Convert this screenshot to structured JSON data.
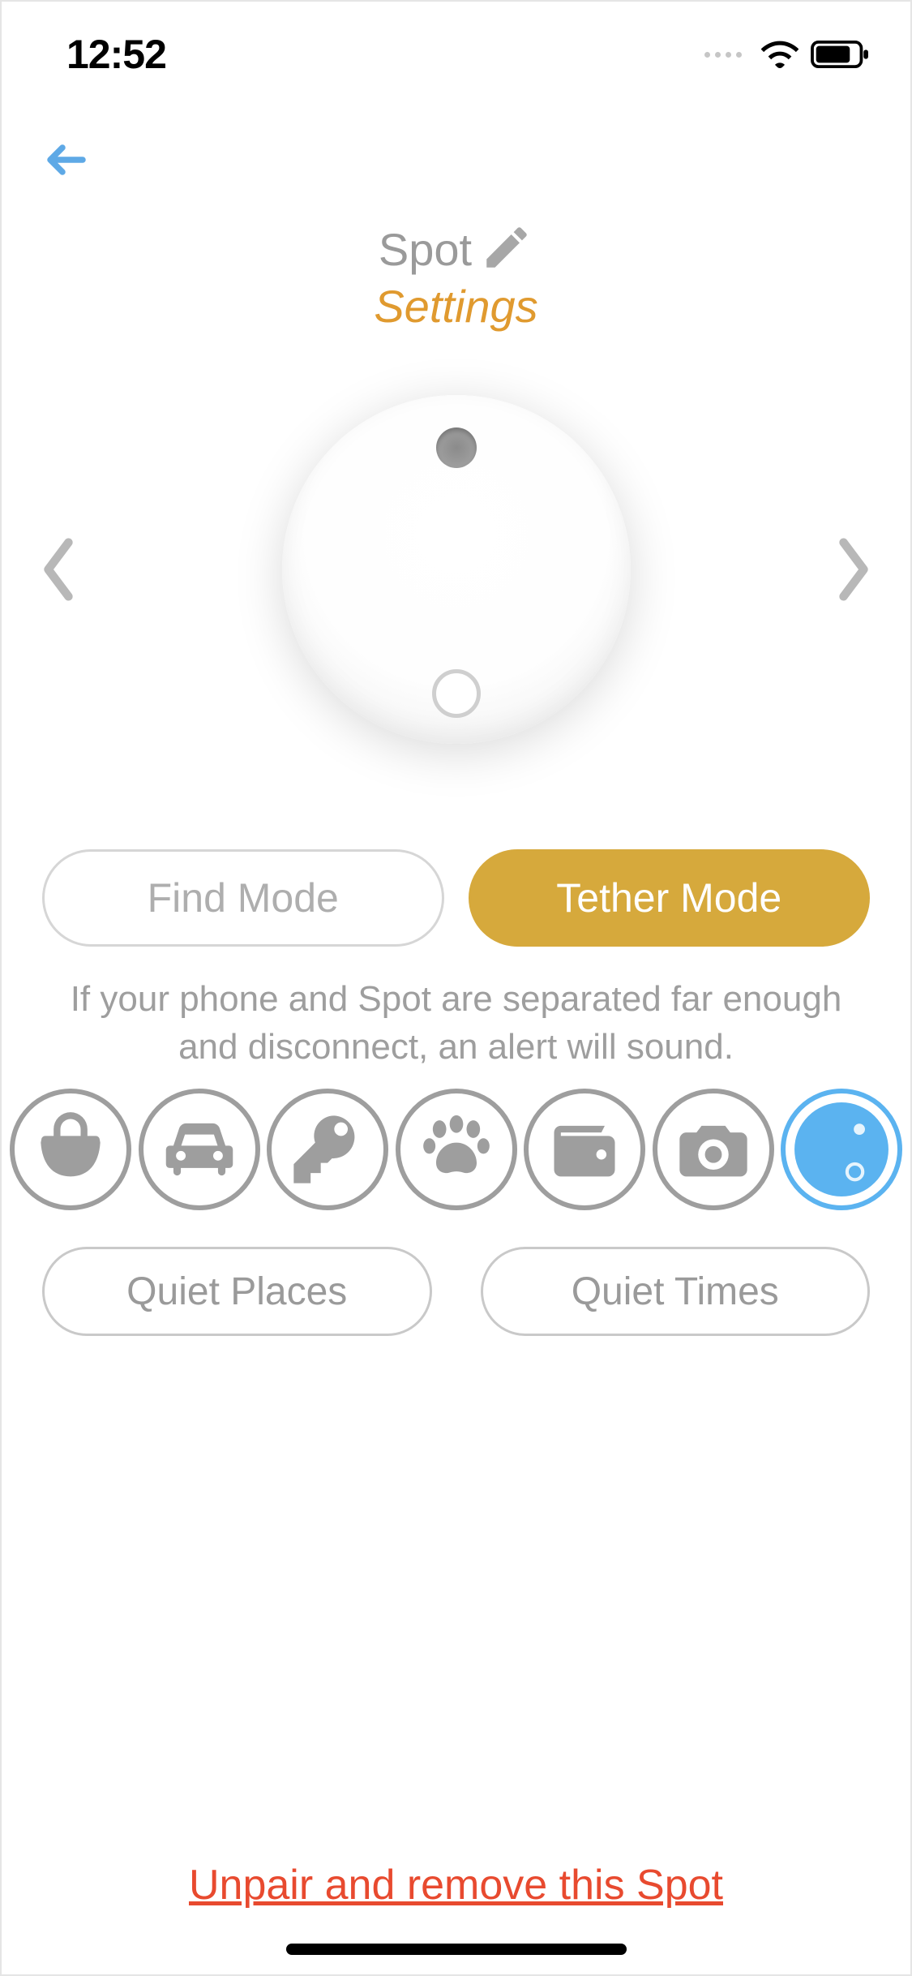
{
  "status": {
    "time": "12:52"
  },
  "header": {
    "device_name": "Spot",
    "subtitle": "Settings"
  },
  "modes": {
    "find_label": "Find Mode",
    "tether_label": "Tether Mode",
    "selected": "tether",
    "description": "If your phone and Spot are separated far enough and disconnect, an alert will sound."
  },
  "categories": [
    {
      "id": "bag",
      "selected": false
    },
    {
      "id": "car",
      "selected": false
    },
    {
      "id": "key",
      "selected": false
    },
    {
      "id": "pet",
      "selected": false
    },
    {
      "id": "wallet",
      "selected": false
    },
    {
      "id": "camera",
      "selected": false
    },
    {
      "id": "spot",
      "selected": true
    }
  ],
  "quiet": {
    "places_label": "Quiet Places",
    "times_label": "Quiet Times"
  },
  "footer": {
    "unpair_label": "Unpair and remove this Spot"
  }
}
